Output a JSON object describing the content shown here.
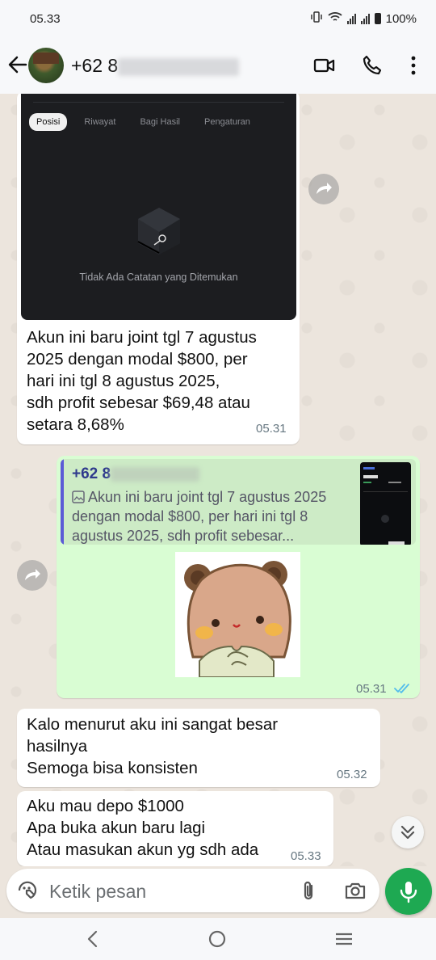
{
  "status_bar": {
    "time": "05.33",
    "battery": "100%"
  },
  "header": {
    "contact_prefix": "+62 8"
  },
  "messages": {
    "m1": {
      "image": {
        "tabs": [
          "Posisi",
          "Riwayat",
          "Bagi Hasil",
          "Pengaturan"
        ],
        "empty_text": "Tidak Ada Catatan yang Ditemukan"
      },
      "text": "Akun ini baru joint tgl 7 agustus\n2025 dengan modal $800, per\nhari ini tgl 8 agustus 2025,\nsdh profit sebesar $69,48 atau\nsetara 8,68%",
      "time": "05.31"
    },
    "m2": {
      "quote_author": "+62 8",
      "quote_text": "Akun ini baru joint tgl 7 agustus 2025 dengan modal $800, per hari ini tgl 8 agustus 2025, sdh profit sebesar...",
      "time": "05.31"
    },
    "m3": {
      "text": "Kalo menurut aku ini sangat besar\nhasilnya\nSemoga bisa konsisten",
      "time": "05.32"
    },
    "m4": {
      "text": "Aku mau depo $1000\nApa buka akun baru lagi\nAtau masukan akun yg sdh ada",
      "time": "05.33"
    }
  },
  "composer": {
    "placeholder": "Ketik pesan"
  },
  "colors": {
    "accent": "#1ea952",
    "outgoing_bubble": "#d9fdd3",
    "read_ticks": "#53bdeb"
  }
}
